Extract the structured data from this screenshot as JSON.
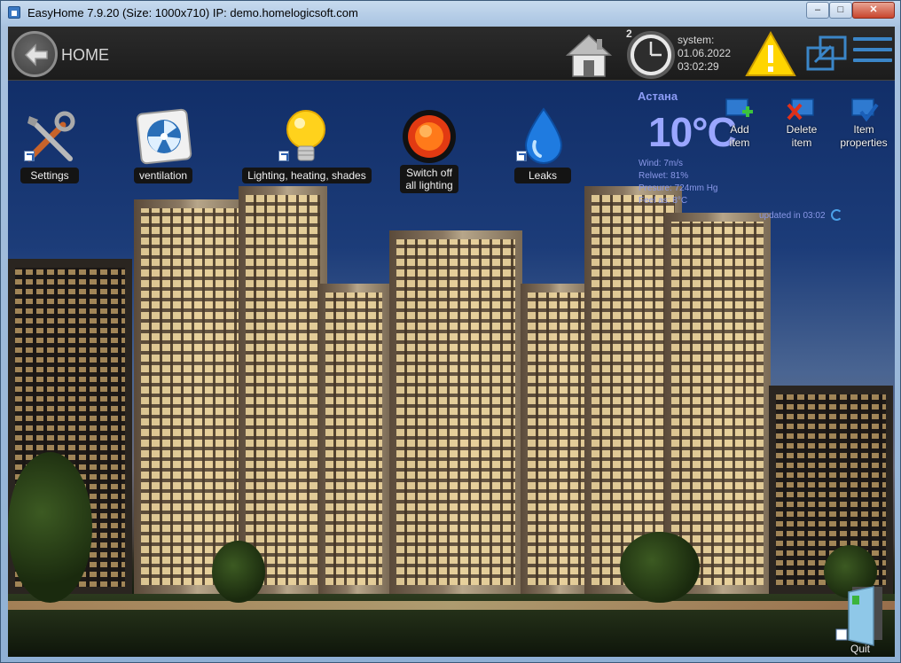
{
  "window": {
    "title": "EasyHome 7.9.20 (Size: 1000x710) IP: demo.homelogicsoft.com",
    "min_glyph": "–",
    "max_glyph": "□",
    "close_glyph": "✕"
  },
  "topbar": {
    "home_label": "HOME",
    "clock_badge": "2",
    "system_label": "system:",
    "date": "01.06.2022",
    "time": "03:02:29",
    "icons": [
      "back-arrow-icon",
      "house-icon",
      "clock-icon",
      "warning-icon",
      "window-icon",
      "menu-icon"
    ]
  },
  "tiles": [
    {
      "label": "Settings",
      "icon": "tools-icon"
    },
    {
      "label": "ventilation",
      "icon": "fan-icon"
    },
    {
      "label": "Lighting, heating, shades",
      "icon": "bulb-icon"
    },
    {
      "label_line1": "Switch off",
      "label_line2": "all lighting",
      "icon": "red-button-icon"
    },
    {
      "label": "Leaks",
      "icon": "water-drop-icon"
    }
  ],
  "weather": {
    "city": "Астана",
    "temp": "10°C",
    "wind": "Wind: 7m/s",
    "humidity": "Relwet: 81%",
    "pressure": "Presure: 724mm Hg",
    "feels": "Feel as: 8°C",
    "updated": "updated in 03:02"
  },
  "edit_actions": [
    {
      "line1": "Add",
      "line2": "item"
    },
    {
      "line1": "Delete",
      "line2": "item"
    },
    {
      "line1": "Item",
      "line2": "properties"
    }
  ],
  "quit": {
    "label": "Quit"
  },
  "colors": {
    "accent_blue": "#3b86c8",
    "weather_text": "#9aa6ff",
    "warning_yellow": "#ffd500"
  }
}
